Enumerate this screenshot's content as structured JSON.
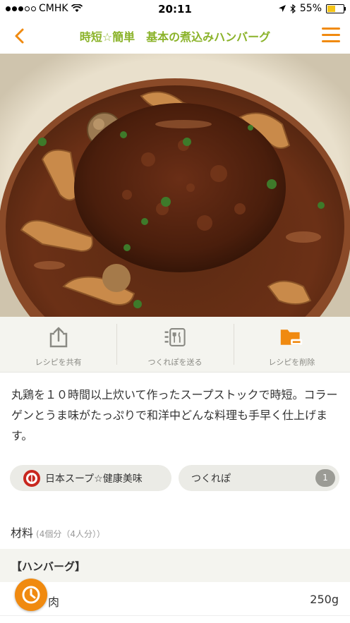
{
  "status_bar": {
    "carrier": "CMHK",
    "time": "20:11",
    "battery_percent": "55%",
    "battery_level": 0.55
  },
  "nav": {
    "title": "時短☆簡単　基本の煮込みハンバーグ",
    "back_icon": "chevron-left-icon",
    "menu_icon": "hamburger-menu-icon"
  },
  "actions": [
    {
      "label": "レシピを共有",
      "icon": "share-icon"
    },
    {
      "label": "つくれぽを送る",
      "icon": "utensils-note-icon"
    },
    {
      "label": "レシピを削除",
      "icon": "folder-remove-icon"
    }
  ],
  "description": "丸鶏を１０時間以上炊いて作ったスープストックで時短。コラーゲンとうま味がたっぷりで和洋中どんな料理も手早く仕上げます。",
  "author": {
    "name": "日本スープ☆健康美味"
  },
  "tsukurepo": {
    "label": "つくれぽ",
    "count": "1"
  },
  "ingredients": {
    "title": "材料",
    "servings": "(4個分（4人分））",
    "groups": [
      {
        "name": "【ハンバーグ】",
        "items": [
          {
            "name": "合い挽き肉",
            "visible_name": "肉",
            "amount": "250g"
          }
        ]
      }
    ]
  },
  "colors": {
    "accent_orange": "#f08a10",
    "title_green": "#8bb32a",
    "panel_bg": "#f4f4ef"
  }
}
